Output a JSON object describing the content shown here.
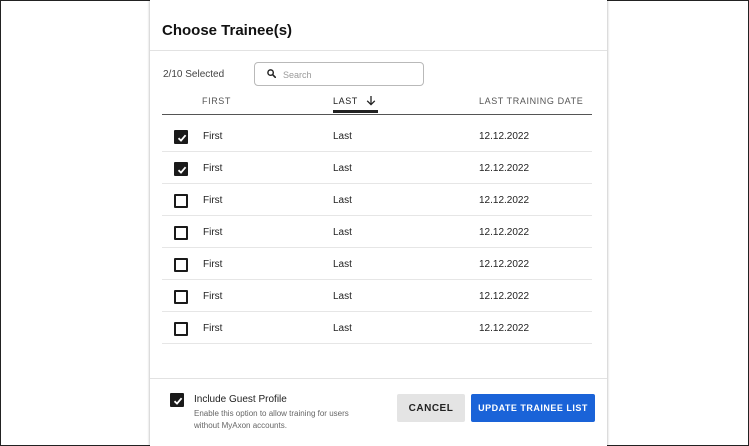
{
  "dialog": {
    "title": "Choose Trainee(s)",
    "selected_count": "2/10 Selected",
    "search": {
      "placeholder": "Search",
      "value": ""
    },
    "columns": {
      "first": "FIRST",
      "last": "LAST",
      "last_training_date": "LAST TRAINING DATE"
    },
    "sort": {
      "column": "last",
      "direction": "descending"
    },
    "rows": [
      {
        "checked": true,
        "first": "First",
        "last": "Last",
        "date": "12.12.2022"
      },
      {
        "checked": true,
        "first": "First",
        "last": "Last",
        "date": "12.12.2022"
      },
      {
        "checked": false,
        "first": "First",
        "last": "Last",
        "date": "12.12.2022"
      },
      {
        "checked": false,
        "first": "First",
        "last": "Last",
        "date": "12.12.2022"
      },
      {
        "checked": false,
        "first": "First",
        "last": "Last",
        "date": "12.12.2022"
      },
      {
        "checked": false,
        "first": "First",
        "last": "Last",
        "date": "12.12.2022"
      },
      {
        "checked": false,
        "first": "First",
        "last": "Last",
        "date": "12.12.2022"
      }
    ],
    "guest": {
      "checked": true,
      "label": "Include Guest Profile",
      "help": "Enable this option to allow training for users without MyAxon accounts."
    },
    "buttons": {
      "cancel": "CANCEL",
      "update": "UPDATE TRAINEE LIST"
    }
  },
  "colors": {
    "primary": "#1a63d8",
    "checkbox": "#1a1a1a",
    "cancel_bg": "#e4e4e4"
  }
}
